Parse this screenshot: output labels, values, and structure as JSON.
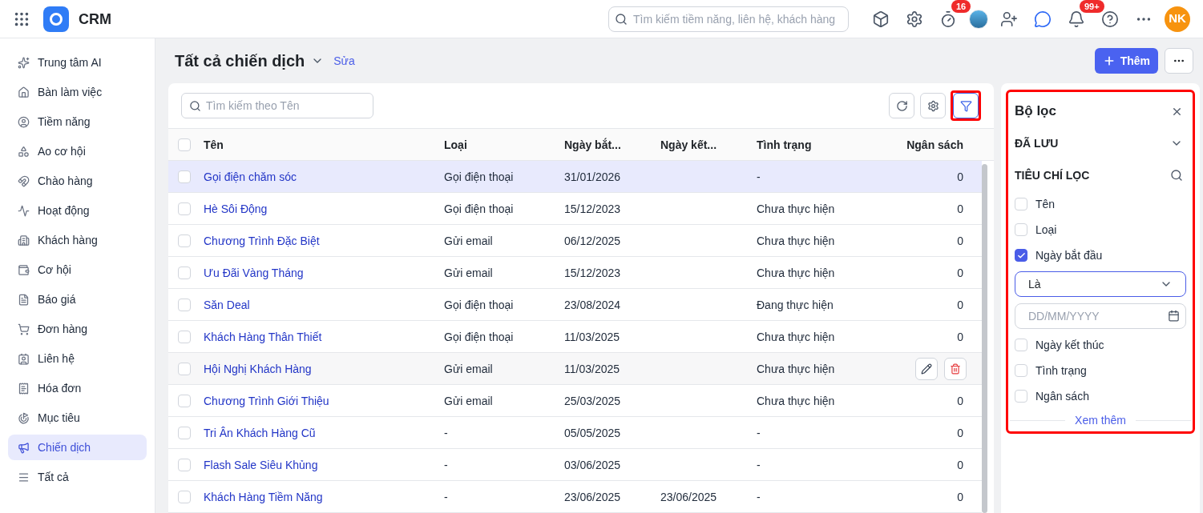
{
  "app": {
    "name": "CRM"
  },
  "header": {
    "search": {
      "placeholder": "Tìm kiếm tiềm năng, liên hệ, khách hàng"
    },
    "timer_badge": "16",
    "notification_badge": "99+",
    "user_initials": "NK"
  },
  "sidebar": {
    "items": [
      {
        "label": "Trung tâm AI",
        "selected": false
      },
      {
        "label": "Bàn làm việc",
        "selected": false
      },
      {
        "label": "Tiềm năng",
        "selected": false
      },
      {
        "label": "Ao cơ hội",
        "selected": false
      },
      {
        "label": "Chào hàng",
        "selected": false
      },
      {
        "label": "Hoạt động",
        "selected": false
      },
      {
        "label": "Khách hàng",
        "selected": false
      },
      {
        "label": "Cơ hội",
        "selected": false
      },
      {
        "label": "Báo giá",
        "selected": false
      },
      {
        "label": "Đơn hàng",
        "selected": false
      },
      {
        "label": "Liên hệ",
        "selected": false
      },
      {
        "label": "Hóa đơn",
        "selected": false
      },
      {
        "label": "Mục tiêu",
        "selected": false
      },
      {
        "label": "Chiến dịch",
        "selected": true
      },
      {
        "label": "Tất cả",
        "selected": false
      }
    ]
  },
  "page": {
    "title": "Tất cả chiến dịch",
    "edit_link": "Sửa",
    "add_button": "Thêm"
  },
  "table": {
    "search": {
      "placeholder": "Tìm kiếm theo Tên"
    },
    "filter_button": {
      "highlighted": true
    },
    "select_all_checked": false,
    "columns": [
      "Tên",
      "Loại",
      "Ngày bắt...",
      "Ngày kết...",
      "Tình trạng",
      "Ngân sách"
    ],
    "rows": [
      {
        "cells": [
          "Gọi điện chăm sóc",
          "Gọi điện thoại",
          "31/01/2026",
          "",
          "-",
          "0"
        ],
        "selected": true,
        "hovered": false
      },
      {
        "cells": [
          "Hè Sôi Động",
          "Gọi điện thoại",
          "15/12/2023",
          "",
          "Chưa thực hiện",
          "0"
        ],
        "selected": false,
        "hovered": false
      },
      {
        "cells": [
          "Chương Trình Đặc Biệt",
          "Gửi email",
          "06/12/2025",
          "",
          "Chưa thực hiện",
          "0"
        ],
        "selected": false,
        "hovered": false
      },
      {
        "cells": [
          "Ưu Đãi Vàng Tháng",
          "Gửi email",
          "15/12/2023",
          "",
          "Chưa thực hiện",
          "0"
        ],
        "selected": false,
        "hovered": false
      },
      {
        "cells": [
          "Săn Deal",
          "Gọi điện thoại",
          "23/08/2024",
          "",
          "Đang thực hiện",
          "0"
        ],
        "selected": false,
        "hovered": false
      },
      {
        "cells": [
          "Khách Hàng Thân Thiết",
          "Gọi điện thoại",
          "11/03/2025",
          "",
          "Chưa thực hiện",
          "0"
        ],
        "selected": false,
        "hovered": false
      },
      {
        "cells": [
          "Hội Nghị Khách Hàng",
          "Gửi email",
          "11/03/2025",
          "",
          "Chưa thực hiện",
          ""
        ],
        "selected": false,
        "hovered": true
      },
      {
        "cells": [
          "Chương Trình Giới Thiệu",
          "Gửi email",
          "25/03/2025",
          "",
          "Chưa thực hiện",
          "0"
        ],
        "selected": false,
        "hovered": false
      },
      {
        "cells": [
          "Tri Ân Khách Hàng Cũ",
          "-",
          "05/05/2025",
          "",
          "-",
          "0"
        ],
        "selected": false,
        "hovered": false
      },
      {
        "cells": [
          "Flash Sale Siêu Khủng",
          "-",
          "03/06/2025",
          "",
          "-",
          "0"
        ],
        "selected": false,
        "hovered": false
      },
      {
        "cells": [
          "Khách Hàng Tiềm Năng",
          "-",
          "23/06/2025",
          "23/06/2025",
          "-",
          "0"
        ],
        "selected": false,
        "hovered": false
      }
    ]
  },
  "filter_panel": {
    "title": "Bộ lọc",
    "highlighted": true,
    "saved_section": "ĐÃ LƯU",
    "criteria_section": "TIÊU CHÍ LỌC",
    "criteria": [
      {
        "label": "Tên",
        "checked": false
      },
      {
        "label": "Loại",
        "checked": false
      },
      {
        "label": "Ngày bắt đầu",
        "checked": true,
        "operator": "Là",
        "date_placeholder": "DD/MM/YYYY"
      },
      {
        "label": "Ngày kết thúc",
        "checked": false
      },
      {
        "label": "Tình trạng",
        "checked": false
      },
      {
        "label": "Ngân sách",
        "checked": false
      }
    ],
    "more_link": "Xem thêm"
  }
}
